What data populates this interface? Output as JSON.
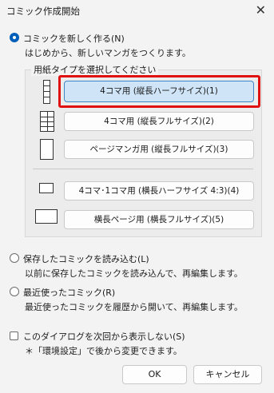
{
  "window": {
    "title": "コミック作成開始",
    "close_symbol": "✕"
  },
  "options": {
    "new_comic": {
      "label": "コミックを新しく作る(N)",
      "description": "はじめから、新しいマンガをつくります。",
      "checked": true
    },
    "load_saved": {
      "label": "保存したコミックを読み込む(L)",
      "description": "以前に保存したコミックを読み込んで、再編集します。",
      "checked": false
    },
    "recent": {
      "label": "最近使ったコミック(R)",
      "description": "最近使ったコミックを履歴から開いて、再編集します。",
      "checked": false
    }
  },
  "paper_group": {
    "title": "用紙タイプを選択してください",
    "buttons": [
      {
        "label": "4コマ用 (縦長ハーフサイズ)(1)",
        "selected": true
      },
      {
        "label": "4コマ用 (縦長フルサイズ)(2)",
        "selected": false
      },
      {
        "label": "ページマンガ用 (縦長フルサイズ)(3)",
        "selected": false
      },
      {
        "label": "4コマ･1コマ用 (横長ハーフサイズ 4:3)(4)",
        "selected": false
      },
      {
        "label": "横長ページ用 (横長フルサイズ)(5)",
        "selected": false
      }
    ]
  },
  "dont_show": {
    "label": "このダイアログを次回から表示しない(S)",
    "note": "＊「環境設定」で後から変更できます。",
    "checked": false
  },
  "footer": {
    "ok_label": "OK",
    "cancel_label": "キャンセル"
  },
  "colors": {
    "highlight": "#e01010",
    "selected_button": "#cfe4f7",
    "accent": "#005fb8"
  }
}
